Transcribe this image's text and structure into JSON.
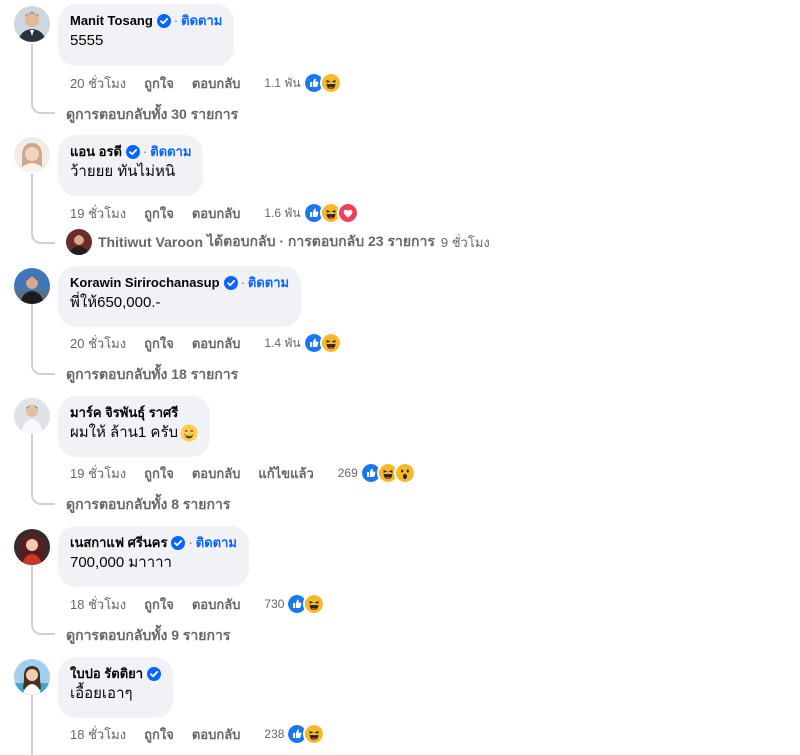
{
  "labels": {
    "follow": "ติดตาม",
    "like": "ถูกใจ",
    "reply": "ตอบกลับ",
    "edited": "แก้ไขแล้ว",
    "dot": "·"
  },
  "colors": {
    "accent": "#0866ff",
    "bubble": "#f0f2f5",
    "meta": "#65676b",
    "like": "#1877f2",
    "haha": "#f7b928",
    "love": "#f33e58"
  },
  "comments": [
    {
      "name": "Manit Tosang",
      "text": "5555",
      "time": "20 ชั่วโมง",
      "reactions": "1.1 พัน",
      "reaction_icons": [
        "like-icon",
        "haha-icon"
      ],
      "replies": "ดูการตอบกลับทั้ง 30 รายการ"
    },
    {
      "name": "แอน อรดี",
      "text": "ว้ายยย ทันไม่หนิ",
      "time": "19 ชั่วโมง",
      "reactions": "1.6 พัน",
      "reaction_icons": [
        "like-icon",
        "haha-icon",
        "love-icon"
      ],
      "reply_preview": {
        "name": "Thitiwut Varoon",
        "action": "ได้ตอบกลับ · การตอบกลับ 23 รายการ",
        "time": "9 ชั่วโมง"
      }
    },
    {
      "name": "Korawin Sirirochanasup",
      "text": "พี่ให้650,000.-",
      "time": "20 ชั่วโมง",
      "reactions": "1.4 พัน",
      "reaction_icons": [
        "like-icon",
        "haha-icon"
      ],
      "replies": "ดูการตอบกลับทั้ง 18 รายการ"
    },
    {
      "name": "มาร์ค จิรพันธุ์ ราศรี",
      "text": "ผมให้ ล้าน1 ครับ",
      "text_emoji": "grinning-emoji",
      "time": "19 ชั่วโมง",
      "reactions": "269",
      "reaction_icons": [
        "like-icon",
        "haha-icon",
        "wow-icon"
      ],
      "replies": "ดูการตอบกลับทั้ง 8 รายการ"
    },
    {
      "name": "เนสกาแฟ ศรีนคร",
      "text": "700,000 มาาาา",
      "time": "18 ชั่วโมง",
      "reactions": "730",
      "reaction_icons": [
        "like-icon",
        "haha-icon"
      ],
      "replies": "ดูการตอบกลับทั้ง 9 รายการ"
    },
    {
      "name": "ใบปอ รัตติยา",
      "text": "เอื้อยเอาๆ",
      "time": "18 ชั่วโมง",
      "reactions": "238",
      "reaction_icons": [
        "like-icon",
        "haha-icon"
      ]
    }
  ]
}
